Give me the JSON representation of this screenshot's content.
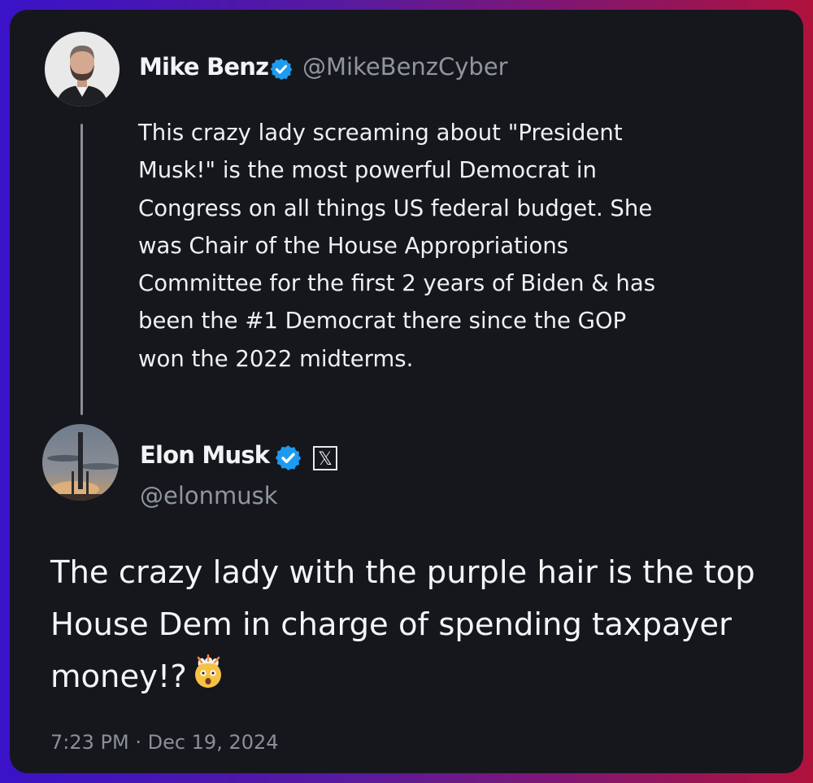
{
  "reply_tweet": {
    "author_name": "Mike Benz",
    "author_handle": "@MikeBenzCyber",
    "text_lines": [
      "This crazy lady screaming about \"President",
      "Musk!\" is the most powerful Democrat in",
      "Congress on all things US federal budget. She",
      "was Chair of the House Appropriations",
      "Committee for the first 2 years of Biden & has",
      "been the #1 Democrat there since the GOP",
      "won the 2022 midterms."
    ]
  },
  "main_tweet": {
    "author_name": "Elon Musk",
    "author_handle": "@elonmusk",
    "affiliate_badge": "𝕏",
    "text_lines": [
      "The crazy lady with the purple hair is the top",
      "House Dem in charge of spending taxpayer",
      "money!?"
    ],
    "emoji": "exploding-head-icon",
    "timestamp": "7:23 PM · Dec 19, 2024"
  },
  "colors": {
    "card_background": "#15171c",
    "verified_blue": "#1d9bf0",
    "text_primary": "#eef0f2",
    "text_secondary": "#8f969d"
  }
}
